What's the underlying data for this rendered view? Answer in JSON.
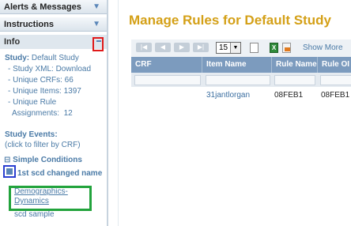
{
  "sidebar": {
    "alerts_label": "Alerts & Messages",
    "instructions_label": "Instructions",
    "info_label": "Info",
    "study_label": "Study:",
    "study_name": "Default Study",
    "info_items": [
      "- Study XML: Download",
      "- Unique CRFs:  66",
      "- Unique Items:  1397",
      "- Unique Rule",
      "  Assignments:  12"
    ],
    "study_events_label": "Study Events:",
    "study_events_hint": "(click to filter by CRF)",
    "simple_conditions_label": "Simple Conditions",
    "event_name": "1st scd changed name",
    "crf_link_line1": "Demographics-",
    "crf_link_line2": "Dynamics",
    "event2_name": "scd sample"
  },
  "main": {
    "title": "Manage Rules for Default Study",
    "page_size": "15",
    "show_more": "Show More",
    "columns": [
      "CRF",
      "Item Name",
      "Rule Name",
      "Rule OI"
    ],
    "rows": [
      {
        "crf": "",
        "item_name": "31jantlorgan",
        "rule_name": "08FEB1",
        "rule_oid": "08FEB1"
      }
    ]
  }
}
